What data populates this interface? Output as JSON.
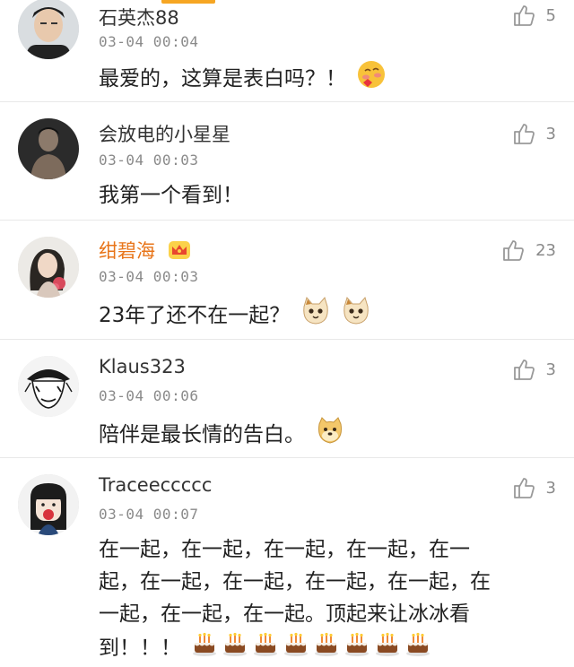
{
  "comments": [
    {
      "name": "石英杰88",
      "time": "03-04 00:04",
      "text": "最爱的，这算是表白吗？！",
      "likes": "5",
      "emojis": [
        "blush-heart-emoji"
      ]
    },
    {
      "name": "会放电的小星星",
      "time": "03-04 00:03",
      "text": "我第一个看到！",
      "likes": "3",
      "emojis": []
    },
    {
      "name": "绀碧海",
      "time": "03-04 00:03",
      "text": "23年了还不在一起？",
      "likes": "23",
      "badge": "crown-icon",
      "emojis": [
        "cat-emoji",
        "cat-emoji"
      ]
    },
    {
      "name": "Klaus323",
      "time": "03-04 00:06",
      "text": "陪伴是最长情的告白。",
      "likes": "3",
      "emojis": [
        "doge-emoji"
      ]
    },
    {
      "name": "Traceeccccc",
      "time": "03-04 00:07",
      "lines": [
        "在一起，在一起，在一起，在一起，在一",
        "起，在一起，在一起，在一起，在一起，在",
        "一起，在一起，在一起。顶起来让冰冰看",
        "到！！！"
      ],
      "likes": "3",
      "emojis": [
        "cake-emoji",
        "cake-emoji",
        "cake-emoji",
        "cake-emoji",
        "cake-emoji",
        "cake-emoji",
        "cake-emoji",
        "cake-emoji"
      ]
    }
  ],
  "colors": {
    "vip_name": "#e8751a",
    "muted": "#8a8a8a",
    "divider": "#e8e8e8"
  }
}
